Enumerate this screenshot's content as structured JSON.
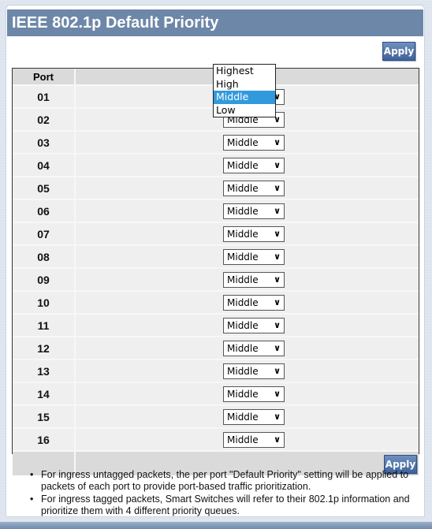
{
  "page": {
    "title": "IEEE 802.1p Default Priority",
    "apply_label": "Apply"
  },
  "table": {
    "headers": [
      "Port",
      ""
    ],
    "rows": [
      {
        "port": "01",
        "priority": "Middle"
      },
      {
        "port": "02",
        "priority": "Middle"
      },
      {
        "port": "03",
        "priority": "Middle"
      },
      {
        "port": "04",
        "priority": "Middle"
      },
      {
        "port": "05",
        "priority": "Middle"
      },
      {
        "port": "06",
        "priority": "Middle"
      },
      {
        "port": "07",
        "priority": "Middle"
      },
      {
        "port": "08",
        "priority": "Middle"
      },
      {
        "port": "09",
        "priority": "Middle"
      },
      {
        "port": "10",
        "priority": "Middle"
      },
      {
        "port": "11",
        "priority": "Middle"
      },
      {
        "port": "12",
        "priority": "Middle"
      },
      {
        "port": "13",
        "priority": "Middle"
      },
      {
        "port": "14",
        "priority": "Middle"
      },
      {
        "port": "15",
        "priority": "Middle"
      },
      {
        "port": "16",
        "priority": "Middle"
      }
    ]
  },
  "dropdown": {
    "open_for_port": "01",
    "options": [
      "Highest",
      "High",
      "Middle",
      "Low"
    ],
    "highlighted": "Middle"
  },
  "notes": [
    "For ingress untagged packets, the per port \"Default Priority\" setting will be applied to packets of each port to provide port-based traffic prioritization.",
    "For ingress tagged packets, Smart Switches will refer to their 802.1p information and prioritize them with 4 different priority queues."
  ],
  "colors": {
    "title_bar": "#6d87a8",
    "button": "#4a6ea3",
    "highlight": "#3399dd"
  }
}
